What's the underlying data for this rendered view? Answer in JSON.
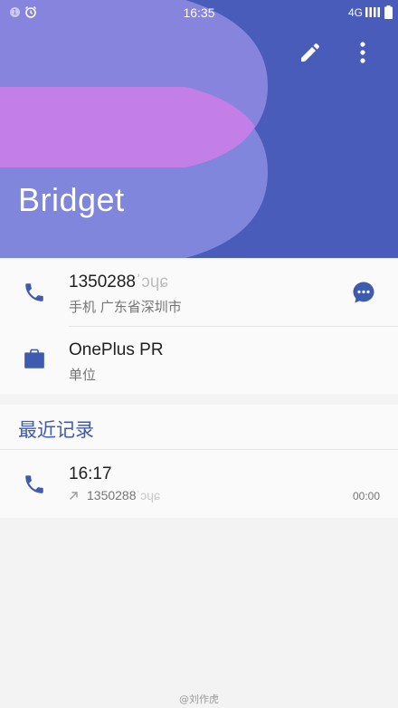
{
  "status_bar": {
    "notification_count": "1",
    "time": "16:35",
    "network": "4G"
  },
  "header": {
    "name": "Bridget",
    "colors": {
      "background": "#4a5cb9",
      "shape_light": "#8784de",
      "shape_pink": "#c47ee8",
      "shape_mid": "#8086dc"
    }
  },
  "contact": {
    "phone": {
      "number": "1350288",
      "redacted_suffix": "ʾɔɥɕ",
      "label": "手机  广东省深圳市"
    },
    "company": {
      "name": "OnePlus PR",
      "label": "单位"
    }
  },
  "recent": {
    "title": "最近记录",
    "calls": [
      {
        "time": "16:17",
        "number": "1350288",
        "redacted_suffix": "ʾɔɥɕ",
        "duration": "00:00"
      }
    ]
  },
  "accent_color": "#3f5bb0",
  "watermark": "@刘作虎"
}
